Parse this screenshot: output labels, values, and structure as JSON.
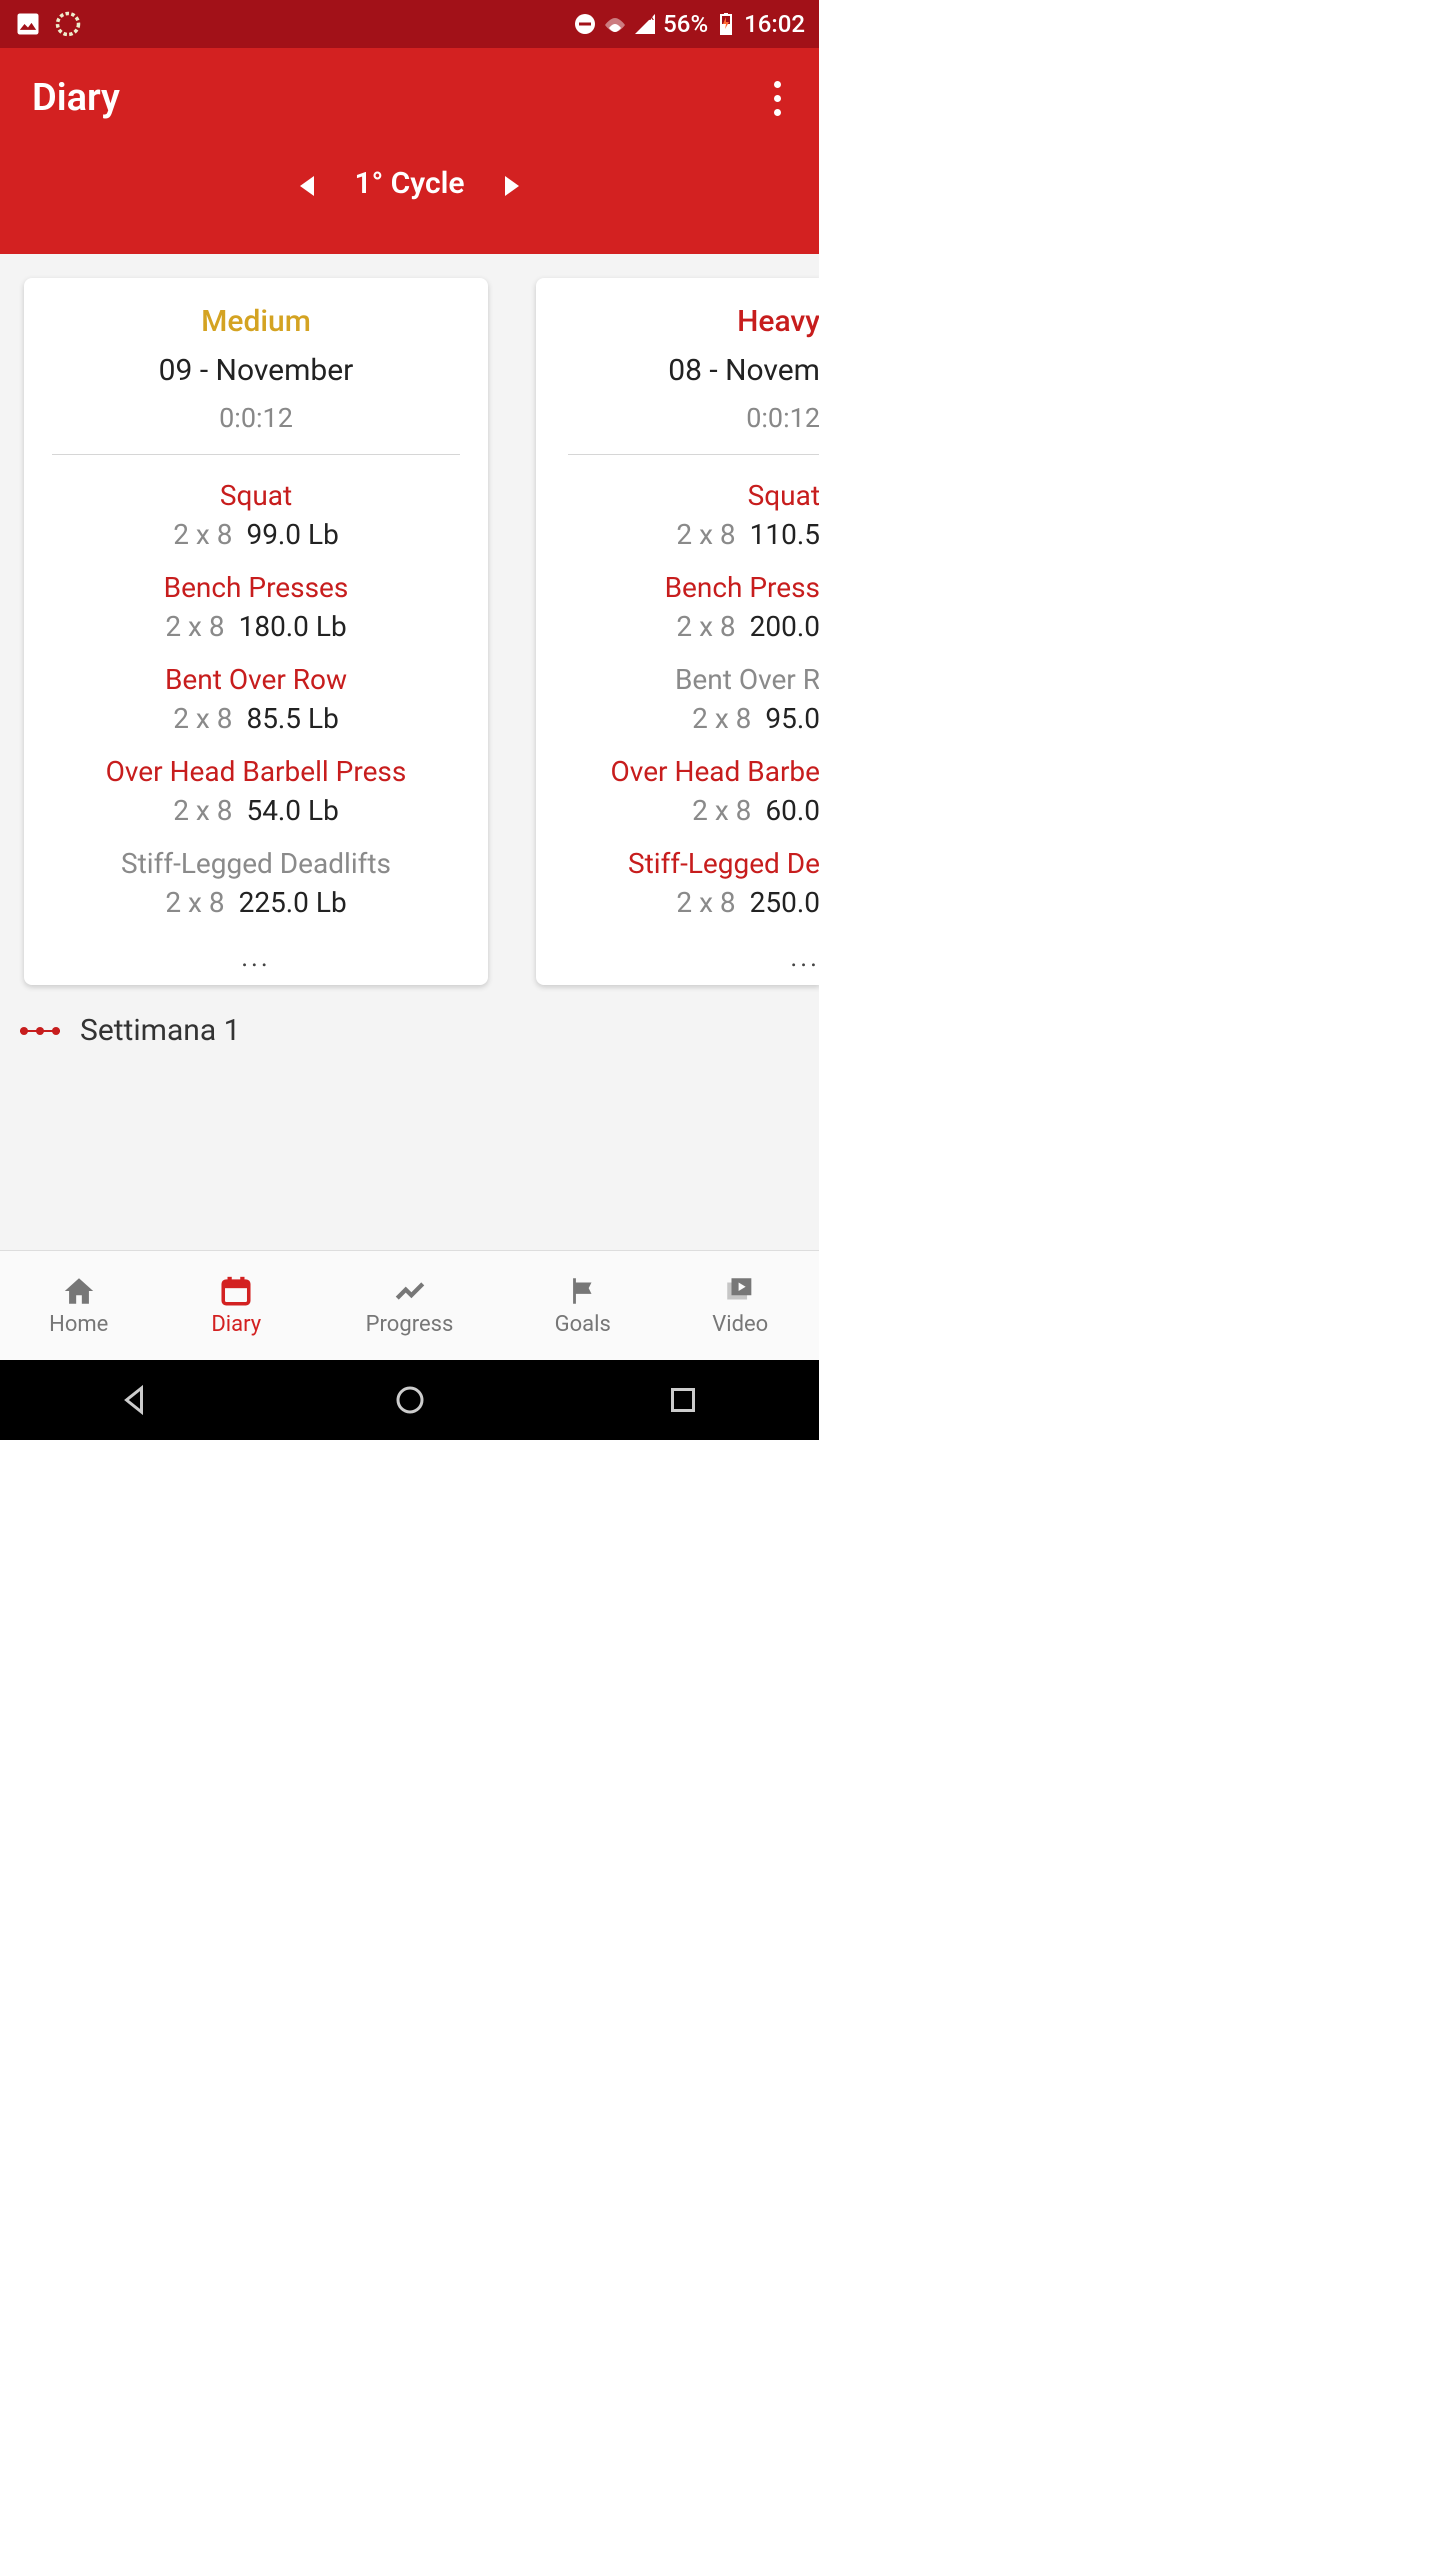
{
  "status": {
    "battery": "56%",
    "time": "16:02"
  },
  "header": {
    "title": "Diary",
    "cycle": "1° Cycle"
  },
  "cards": [
    {
      "intensity": "Medium",
      "date": "09 - November",
      "timer": "0:0:12",
      "exercises": [
        {
          "name": "Squat",
          "sets": "2 x 8",
          "weight": "99.0 Lb",
          "muted": false
        },
        {
          "name": "Bench Presses",
          "sets": "2 x 8",
          "weight": "180.0 Lb",
          "muted": false
        },
        {
          "name": "Bent Over Row",
          "sets": "2 x 8",
          "weight": "85.5 Lb",
          "muted": false
        },
        {
          "name": "Over Head Barbell Press",
          "sets": "2 x 8",
          "weight": "54.0 Lb",
          "muted": false
        },
        {
          "name": "Stiff-Legged Deadlifts",
          "sets": "2 x 8",
          "weight": "225.0 Lb",
          "muted": true
        }
      ],
      "more": "..."
    },
    {
      "intensity": "Heavy",
      "date": "08 - Novem",
      "timer": "0:0:12",
      "exercises": [
        {
          "name": "Squat",
          "sets": "2 x 8",
          "weight": "110.5",
          "muted": false
        },
        {
          "name": "Bench Press",
          "sets": "2 x 8",
          "weight": "200.0",
          "muted": false
        },
        {
          "name": "Bent Over R",
          "sets": "2 x 8",
          "weight": "95.0",
          "muted": true
        },
        {
          "name": "Over Head Barbe",
          "sets": "2 x 8",
          "weight": "60.0",
          "muted": false
        },
        {
          "name": "Stiff-Legged De",
          "sets": "2 x 8",
          "weight": "250.0",
          "muted": false
        }
      ],
      "more": "..."
    }
  ],
  "week": "Settimana 1",
  "nav": {
    "home": "Home",
    "diary": "Diary",
    "progress": "Progress",
    "goals": "Goals",
    "video": "Video"
  }
}
